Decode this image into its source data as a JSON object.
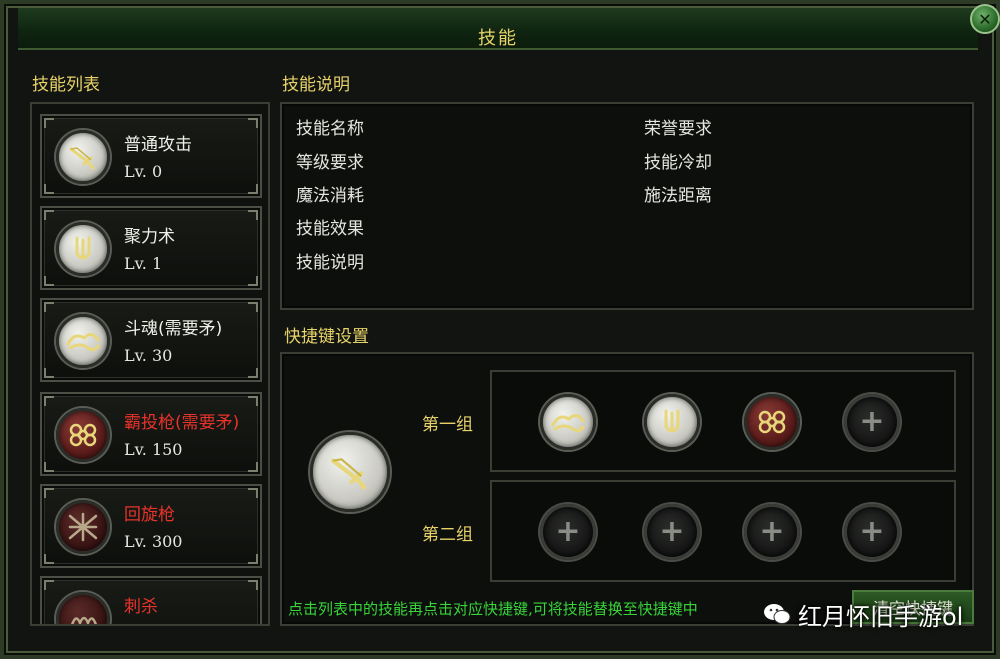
{
  "window": {
    "title": "技能",
    "close_label": "✕"
  },
  "skill_list": {
    "header": "技能列表",
    "level_prefix": "Lv.",
    "items": [
      {
        "name": "普通攻击",
        "level": "Lv.  0",
        "color": "#f0f0ea",
        "icon": "sword-icon",
        "unlocked": true
      },
      {
        "name": "聚力术",
        "level": "Lv.  1",
        "color": "#f0f0ea",
        "icon": "fork-icon",
        "unlocked": true
      },
      {
        "name": "斗魂(需要矛)",
        "level": "Lv.  30",
        "color": "#f0f0ea",
        "icon": "cloud-icon",
        "unlocked": true
      },
      {
        "name": "霸投枪(需要矛)",
        "level": "Lv.  150",
        "color": "#e8332a",
        "icon": "knot-icon",
        "unlocked": false
      },
      {
        "name": "回旋枪",
        "level": "Lv.  300",
        "color": "#e8332a",
        "icon": "crossed-spears-icon",
        "unlocked": false
      },
      {
        "name": "刺杀",
        "level": "",
        "color": "#e8332a",
        "icon": "thrust-icon",
        "unlocked": false
      }
    ]
  },
  "description": {
    "header": "技能说明",
    "left_fields": [
      "技能名称",
      "等级要求",
      "魔法消耗",
      "技能效果",
      "技能说明"
    ],
    "right_fields": [
      "荣誉要求",
      "技能冷却",
      "施法距离"
    ]
  },
  "shortcuts": {
    "header": "快捷键设置",
    "selected_icon": "sword-icon",
    "groups": [
      {
        "label": "第一组",
        "slots": [
          "cloud-icon",
          "fork-icon",
          "knot-icon",
          "empty"
        ]
      },
      {
        "label": "第二组",
        "slots": [
          "empty",
          "empty",
          "empty",
          "empty"
        ]
      }
    ],
    "hint": "点击列表中的技能再点击对应快捷键,可将技能替换至快捷键中",
    "clear_button": "清空快捷键"
  },
  "watermark": {
    "text": "红月怀旧手游ol"
  }
}
